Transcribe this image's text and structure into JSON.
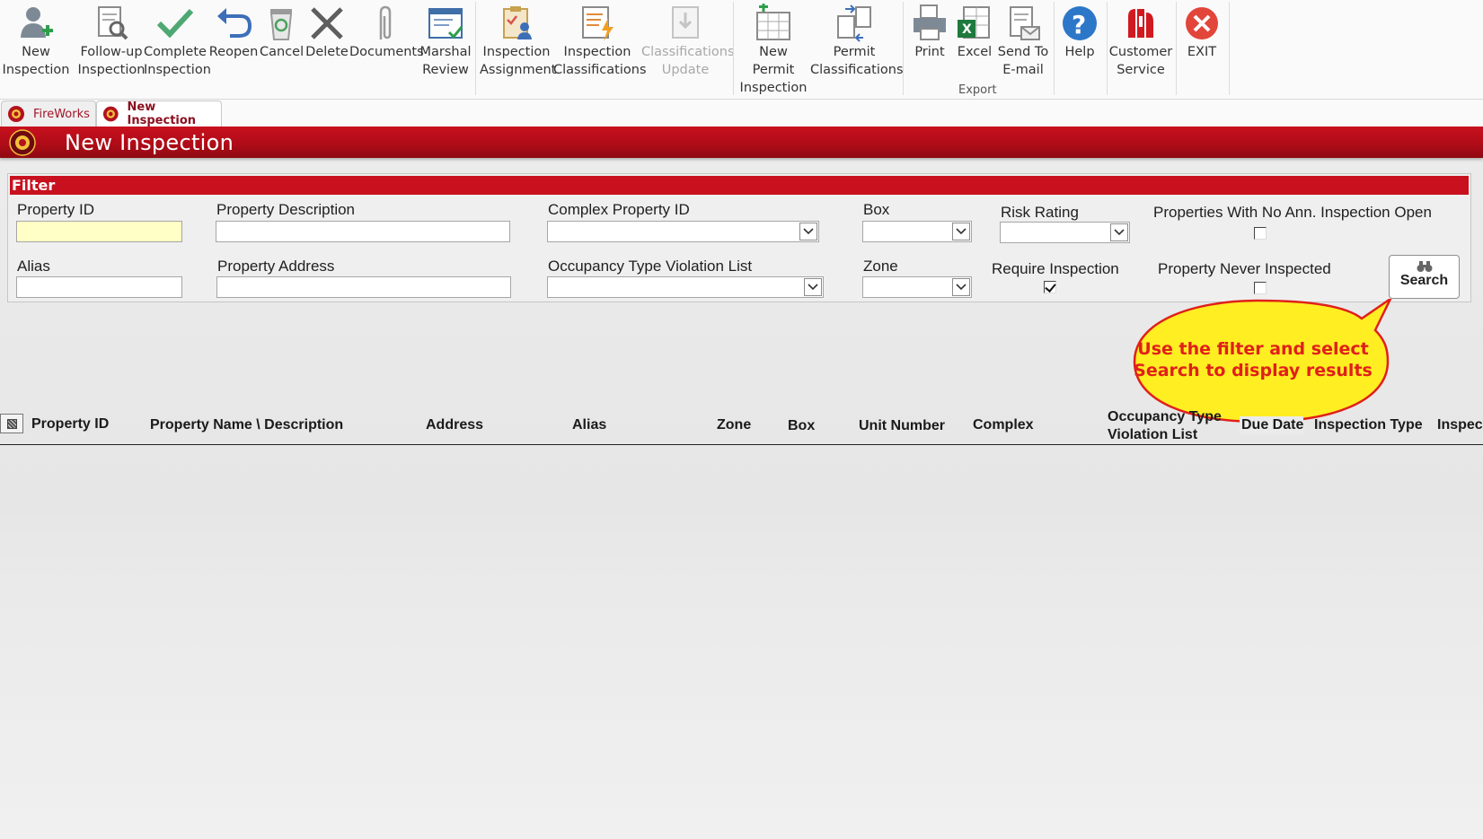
{
  "ribbon": {
    "buttons": [
      {
        "label1": "New",
        "label2": "Inspection",
        "icon": "user-add-icon"
      },
      {
        "label1": "Follow-up",
        "label2": "Inspection",
        "icon": "document-magnify-icon"
      },
      {
        "label1": "Complete",
        "label2": "Inspection",
        "icon": "checkmark-icon"
      },
      {
        "label1": "Reopen",
        "label2": "",
        "icon": "undo-arrow-icon"
      },
      {
        "label1": "Cancel",
        "label2": "",
        "icon": "recycle-bin-icon"
      },
      {
        "label1": "Delete",
        "label2": "",
        "icon": "x-delete-icon"
      },
      {
        "label1": "Documents",
        "label2": "",
        "icon": "paperclip-icon"
      },
      {
        "label1": "Marshal",
        "label2": "Review",
        "icon": "review-chart-icon"
      },
      {
        "label1": "Inspection",
        "label2": "Assignment",
        "icon": "clipboard-user-icon"
      },
      {
        "label1": "Inspection",
        "label2": "Classifications",
        "icon": "document-lightning-icon"
      },
      {
        "label1": "Classifications",
        "label2": "Update",
        "icon": "document-download-icon",
        "disabled": true
      },
      {
        "label1": "New Permit",
        "label2": "Inspection",
        "icon": "grid-plus-icon"
      },
      {
        "label1": "Permit",
        "label2": "Classifications",
        "icon": "documents-exchange-icon"
      },
      {
        "label1": "Print",
        "label2": "",
        "icon": "printer-icon"
      },
      {
        "label1": "Excel",
        "label2": "",
        "icon": "excel-icon"
      },
      {
        "label1": "Send To",
        "label2": "E-mail",
        "icon": "email-document-icon"
      },
      {
        "label1": "Help",
        "label2": "",
        "icon": "help-icon"
      },
      {
        "label1": "Customer",
        "label2": "Service",
        "icon": "customer-service-logo-icon"
      },
      {
        "label1": "EXIT",
        "label2": "",
        "icon": "exit-icon"
      }
    ],
    "export_group_label": "Export"
  },
  "tabs": [
    {
      "label": "FireWorks",
      "active": false
    },
    {
      "label": "New Inspection",
      "active": true
    }
  ],
  "page_title": "New Inspection",
  "filter": {
    "header": "Filter",
    "property_id": {
      "label": "Property ID",
      "value": ""
    },
    "property_description": {
      "label": "Property Description",
      "value": ""
    },
    "complex_property_id": {
      "label": "Complex Property ID",
      "value": ""
    },
    "box": {
      "label": "Box",
      "value": ""
    },
    "risk_rating": {
      "label": "Risk Rating",
      "value": ""
    },
    "no_ann_inspection_open": {
      "label": "Properties With No Ann. Inspection Open",
      "checked": false
    },
    "alias": {
      "label": "Alias",
      "value": ""
    },
    "property_address": {
      "label": "Property Address",
      "value": ""
    },
    "occupancy_type_violation_list": {
      "label": "Occupancy Type Violation List",
      "value": ""
    },
    "zone": {
      "label": "Zone",
      "value": ""
    },
    "require_inspection": {
      "label": "Require Inspection",
      "checked": true
    },
    "property_never_inspected": {
      "label": "Property Never Inspected",
      "checked": false
    },
    "search_button": "Search"
  },
  "callout": {
    "line1": "Use the filter and select",
    "line2": "Search to display results"
  },
  "grid": {
    "columns": [
      "Property ID",
      "Property Name \\ Description",
      "Address",
      "Alias",
      "Zone",
      "Box",
      "Unit Number",
      "Complex",
      "Occupancy Type Violation List",
      "Due Date",
      "Inspection Type",
      "Inspec"
    ],
    "rows": []
  }
}
